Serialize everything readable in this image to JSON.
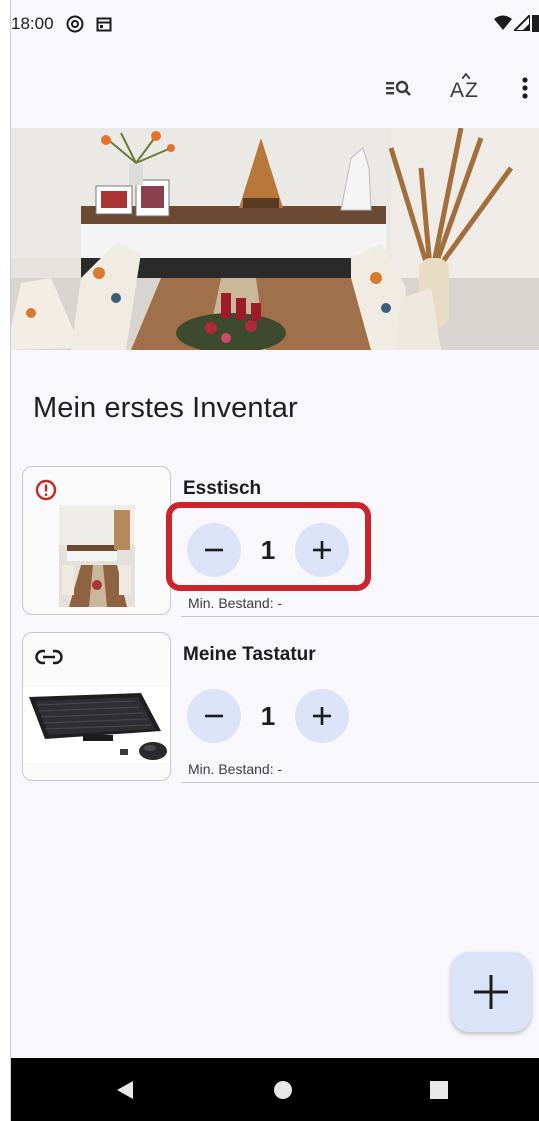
{
  "status_bar": {
    "time": "18:00",
    "icons": [
      "at-sign-icon",
      "calendar-icon",
      "wifi-icon",
      "signal-icon",
      "battery-icon"
    ]
  },
  "app_bar": {
    "actions": [
      "filter-search-icon",
      "sort-az-icon",
      "more-vert-icon"
    ],
    "sort_label_top": "A",
    "sort_label_bottom": "Z"
  },
  "inventory": {
    "title": "Mein erstes Inventar",
    "items": [
      {
        "name": "Esstisch",
        "quantity": "1",
        "min_stock": "Min. Bestand: -",
        "badge": "alert-icon",
        "badge_color": "#c62828"
      },
      {
        "name": "Meine Tastatur",
        "quantity": "1",
        "min_stock": "Min. Bestand: -",
        "badge": "link-icon"
      }
    ]
  },
  "fab": {
    "icon": "plus-icon"
  },
  "nav": {
    "buttons": [
      "back-icon",
      "home-icon",
      "recents-icon"
    ]
  },
  "colors": {
    "background": "#f8f7fc",
    "stepper_button": "#dde3f6",
    "highlight_box": "#c8262c",
    "fab": "#dbe3f8"
  }
}
